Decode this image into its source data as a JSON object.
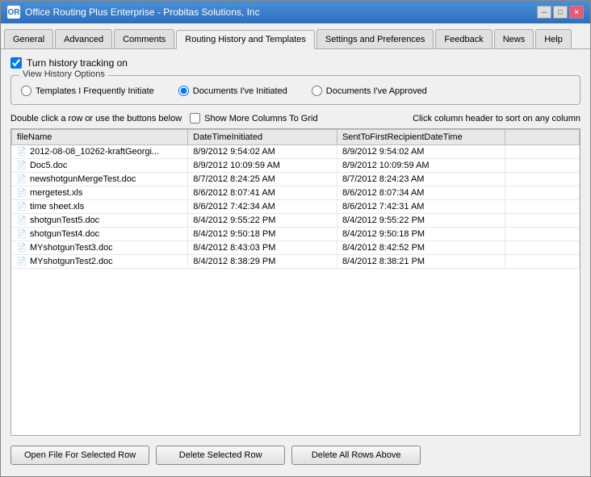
{
  "window": {
    "title": "Office Routing Plus Enterprise - Probitas Solutions, Inc",
    "icon": "OR"
  },
  "titlebar": {
    "minimize_label": "─",
    "maximize_label": "□",
    "close_label": "✕"
  },
  "tabs": [
    {
      "id": "general",
      "label": "General"
    },
    {
      "id": "advanced",
      "label": "Advanced"
    },
    {
      "id": "comments",
      "label": "Comments"
    },
    {
      "id": "routing",
      "label": "Routing History and Templates",
      "active": true
    },
    {
      "id": "settings",
      "label": "Settings and Preferences"
    },
    {
      "id": "feedback",
      "label": "Feedback"
    },
    {
      "id": "news",
      "label": "News"
    },
    {
      "id": "help",
      "label": "Help"
    }
  ],
  "history_tracking": {
    "checkbox_label": "Turn history tracking on",
    "checked": true
  },
  "view_history": {
    "group_title": "View History Options",
    "options": [
      {
        "id": "templates",
        "label": "Templates I Frequently Initiate",
        "selected": false
      },
      {
        "id": "initiated",
        "label": "Documents I've Initiated",
        "selected": true
      },
      {
        "id": "approved",
        "label": "Documents I've Approved",
        "selected": false
      }
    ]
  },
  "table_instructions": {
    "left_text": "Double click a row or use the buttons below",
    "checkbox_label": "Show More Columns To Grid",
    "right_text": "Click column header to sort on any column"
  },
  "table": {
    "columns": [
      {
        "id": "fileName",
        "label": "fileName"
      },
      {
        "id": "dateTimeInitiated",
        "label": "DateTimeInitiated"
      },
      {
        "id": "sentToFirst",
        "label": "SentToFirstRecipientDateTime"
      },
      {
        "id": "extra",
        "label": ""
      }
    ],
    "rows": [
      {
        "fileName": "2012-08-08_10262-kraftGeorgi...",
        "dateTimeInitiated": "8/9/2012 9:54:02 AM",
        "sentToFirst": "8/9/2012 9:54:02 AM",
        "extra": ""
      },
      {
        "fileName": "Doc5.doc",
        "dateTimeInitiated": "8/9/2012 10:09:59 AM",
        "sentToFirst": "8/9/2012 10:09:59 AM",
        "extra": ""
      },
      {
        "fileName": "newshotgunMergeTest.doc",
        "dateTimeInitiated": "8/7/2012 8:24:25 AM",
        "sentToFirst": "8/7/2012 8:24:23 AM",
        "extra": ""
      },
      {
        "fileName": "mergetest.xls",
        "dateTimeInitiated": "8/6/2012 8:07:41 AM",
        "sentToFirst": "8/6/2012 8:07:34 AM",
        "extra": ""
      },
      {
        "fileName": "time sheet.xls",
        "dateTimeInitiated": "8/6/2012 7:42:34 AM",
        "sentToFirst": "8/6/2012 7:42:31 AM",
        "extra": ""
      },
      {
        "fileName": "shotgunTest5.doc",
        "dateTimeInitiated": "8/4/2012 9:55:22 PM",
        "sentToFirst": "8/4/2012 9:55:22 PM",
        "extra": ""
      },
      {
        "fileName": "shotgunTest4.doc",
        "dateTimeInitiated": "8/4/2012 9:50:18 PM",
        "sentToFirst": "8/4/2012 9:50:18 PM",
        "extra": ""
      },
      {
        "fileName": "MYshotgunTest3.doc",
        "dateTimeInitiated": "8/4/2012 8:43:03 PM",
        "sentToFirst": "8/4/2012 8:42:52 PM",
        "extra": ""
      },
      {
        "fileName": "MYshotgunTest2.doc",
        "dateTimeInitiated": "8/4/2012 8:38:29 PM",
        "sentToFirst": "8/4/2012 8:38:21 PM",
        "extra": ""
      }
    ]
  },
  "buttons": {
    "open_file": "Open File For Selected Row",
    "delete_row": "Delete Selected Row",
    "delete_all": "Delete All Rows Above"
  }
}
